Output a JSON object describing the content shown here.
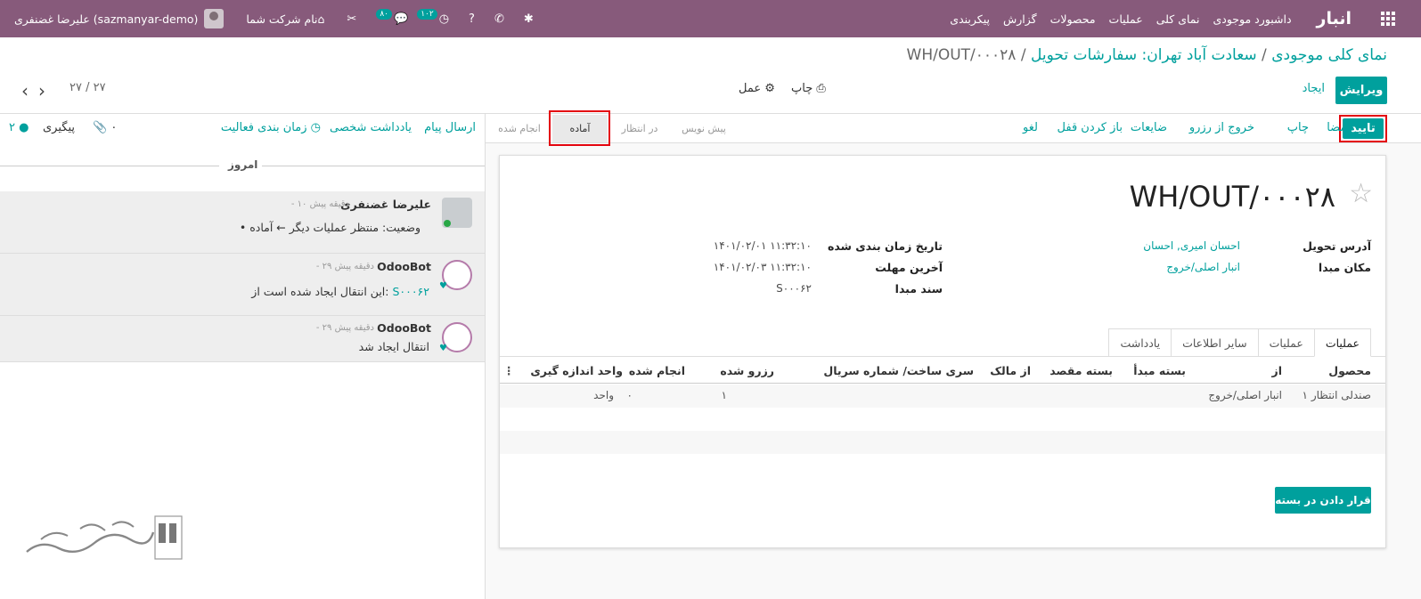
{
  "topbar": {
    "app_name": "انبار",
    "menu": [
      "داشبورد موجودی",
      "نمای کلی",
      "عملیات",
      "محصولات",
      "گزارش",
      "پیکربندی"
    ],
    "user_name": "علیرضا غضنفری (sazmanyar-demo)",
    "company": "نام شرکت شما",
    "activity_count": "۱۰۲",
    "message_count": "۸۰"
  },
  "breadcrumb": {
    "part1": "نمای کلی موجودی",
    "part2": "سعادت آباد تهران: سفارشات تحویل",
    "current": "WH/OUT/۰۰۰۲۸",
    "sep": "/"
  },
  "controls": {
    "edit": "ویرایش",
    "create": "ایجاد",
    "print": "چاپ",
    "action": "عمل",
    "pager": "۲۷ / ۲۷"
  },
  "statusbar": {
    "buttons": [
      "تایید",
      "امضا",
      "چاپ",
      "خروج از رزرو",
      "ضایعات",
      "باز کردن قفل",
      "لغو"
    ],
    "stages": [
      "پیش نویس",
      "در انتظار",
      "آماده",
      "انجام شده"
    ]
  },
  "form": {
    "title": "WH/OUT/۰۰۰۲۸",
    "delivery_address_label": "آدرس تحویل",
    "delivery_address": "احسان امیری, احسان",
    "source_location_label": "مکان مبدا",
    "source_location": "انبار اصلی/خروج",
    "scheduled_date_label": "تاریخ زمان بندی شده",
    "scheduled_date": "۱۴۰۱/۰۲/۰۱ ۱۱:۳۲:۱۰",
    "deadline_label": "آخرین مهلت",
    "deadline": "۱۴۰۱/۰۲/۰۳ ۱۱:۳۲:۱۰",
    "origin_label": "سند مبدا",
    "origin": "S۰۰۰۶۲",
    "tabs": [
      "عملیات",
      "عملیات",
      "سایر اطلاعات",
      "یادداشت"
    ],
    "columns": [
      "محصول",
      "از",
      "بسته مبدأ",
      "بسته مقصد",
      "از مالک",
      "سری ساخت/ شماره سریال",
      "رزرو شده",
      "انجام شده",
      "واحد اندازه گیری"
    ],
    "rows": [
      {
        "product": "صندلی انتظار ۱",
        "from": "انبار اصلی/خروج",
        "reserved": "۱",
        "done": "۰",
        "uom": "واحد"
      }
    ],
    "put_in_pack": "قرار دادن در بسته"
  },
  "chatter": {
    "send_message": "ارسال پیام",
    "log_note": "یادداشت شخصی",
    "schedule_activity": "زمان بندی فعالیت",
    "attachments": "۰",
    "follow": "پیگیری",
    "followers": "۲",
    "today": "امروز",
    "messages": [
      {
        "author": "علیرضا غضنفری",
        "ago": "- ۱۰ دقیقه پیش",
        "body": "وضعیت: منتظر عملیات دیگر ← آماده"
      },
      {
        "author": "OdooBot",
        "ago": "- ۲۹ دقیقه پیش",
        "body": "این انتقال ایجاد شده است از:",
        "link": "S۰۰۰۶۲"
      },
      {
        "author": "OdooBot",
        "ago": "- ۲۹ دقیقه پیش",
        "body": "انتقال ایجاد شد"
      }
    ]
  },
  "colors": {
    "primary": "#875a7b",
    "accent": "#00a09d",
    "highlight": "#e4040e"
  }
}
